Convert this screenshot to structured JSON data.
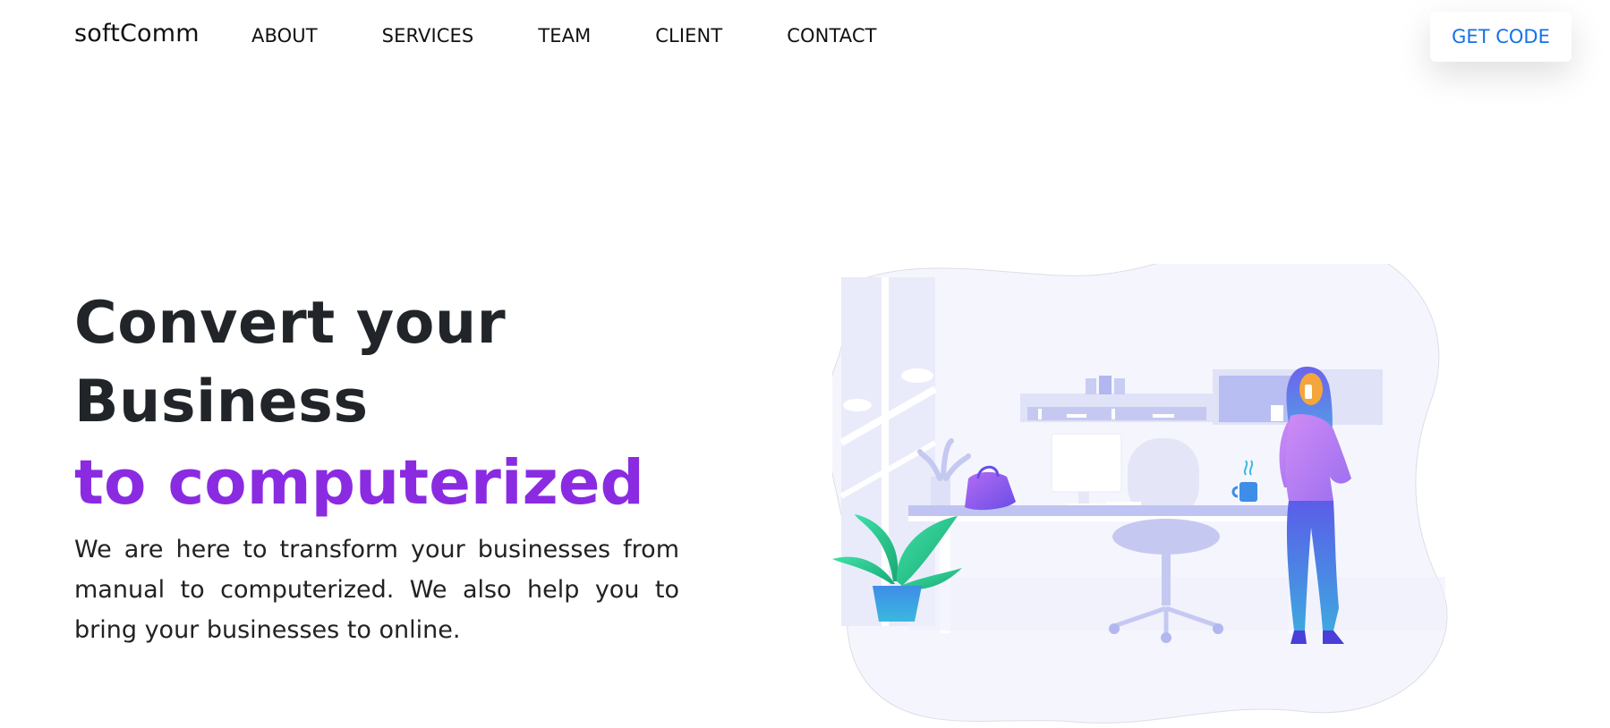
{
  "navbar": {
    "brand": "softComm",
    "links": [
      "ABOUT",
      "SERVICES",
      "TEAM",
      "CLIENT",
      "CONTACT"
    ],
    "cta_label": "GET CODE"
  },
  "hero": {
    "headline_line1": "Convert your",
    "headline_line2": "Business",
    "headline_accent": "to computerized",
    "description": "We are here to transform your businesses from manual to computerized. We also help you to bring your businesses to online."
  },
  "colors": {
    "accent_purple": "#8a2be2",
    "link_blue": "#1670e8",
    "text_dark": "#212529",
    "illustration_bg": "#f5f6fd"
  }
}
